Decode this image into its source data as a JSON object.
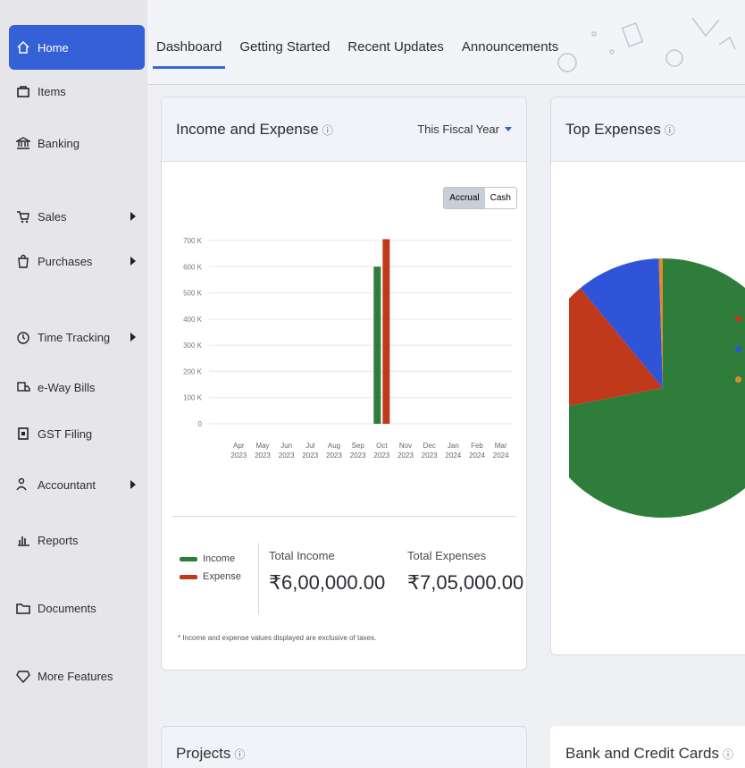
{
  "sidebar": {
    "items": [
      {
        "label": "Home",
        "icon": "home-icon"
      },
      {
        "label": "Items",
        "icon": "bag-icon"
      },
      {
        "label": "Banking",
        "icon": "bank-icon"
      },
      {
        "label": "Sales",
        "icon": "cart-icon"
      },
      {
        "label": "Purchases",
        "icon": "shopping-bag-icon"
      },
      {
        "label": "Time Tracking",
        "icon": "clock-icon"
      },
      {
        "label": "e-Way Bills",
        "icon": "truck-icon"
      },
      {
        "label": "GST Filing",
        "icon": "file-icon"
      },
      {
        "label": "Accountant",
        "icon": "user-group-icon"
      },
      {
        "label": "Reports",
        "icon": "bar-chart-icon"
      },
      {
        "label": "Documents",
        "icon": "folder-icon"
      },
      {
        "label": "More Features",
        "icon": "gem-icon"
      }
    ]
  },
  "header": {
    "tabs": [
      "Dashboard",
      "Getting Started",
      "Recent Updates",
      "Announcements"
    ]
  },
  "income_card": {
    "title": "Income and Expense",
    "period": "This Fiscal Year",
    "toggle": [
      "Accrual",
      "Cash"
    ],
    "legend": [
      "Income",
      "Expense"
    ],
    "total_income_label": "Total Income",
    "total_income": "₹6,00,000.00",
    "total_expense_label": "Total Expenses",
    "total_expense": "₹7,05,000.00",
    "note": "* Income and expense values displayed are exclusive of taxes."
  },
  "top_expenses": {
    "title": "Top Expenses"
  },
  "projects": {
    "title": "Projects"
  },
  "bank_cards": {
    "title": "Bank and Credit Cards"
  },
  "colors": {
    "accent": "#3461d8",
    "income": "#2e7d3a",
    "expense": "#c0391b",
    "blue": "#2f54d8",
    "orange": "#e08a2a"
  },
  "chart_data": {
    "type": "bar",
    "categories": [
      "Apr 2023",
      "May 2023",
      "Jun 2023",
      "Jul 2023",
      "Aug 2023",
      "Sep 2023",
      "Oct 2023",
      "Nov 2023",
      "Dec 2023",
      "Jan 2024",
      "Feb 2024",
      "Mar 2024"
    ],
    "series": [
      {
        "name": "Income",
        "values": [
          0,
          0,
          0,
          0,
          0,
          0,
          600000,
          0,
          0,
          0,
          0,
          0
        ]
      },
      {
        "name": "Expense",
        "values": [
          0,
          0,
          0,
          0,
          0,
          0,
          705000,
          0,
          0,
          0,
          0,
          0
        ]
      }
    ],
    "yticks": [
      "0",
      "100 K",
      "200 K",
      "300 K",
      "400 K",
      "500 K",
      "600 K",
      "700 K"
    ],
    "ylim": [
      0,
      700000
    ],
    "pie": [
      0.72,
      0.17,
      0.105,
      0.005
    ]
  }
}
